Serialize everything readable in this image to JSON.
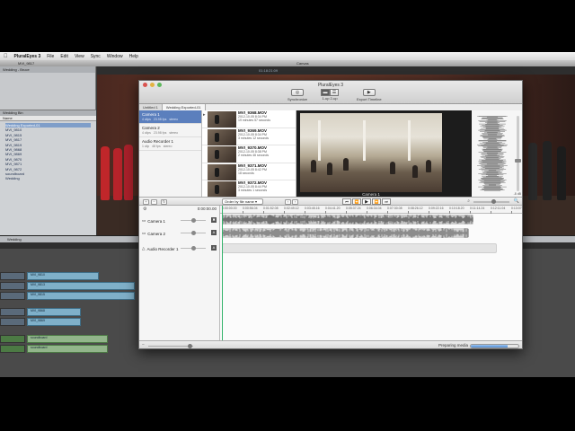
{
  "menubar": {
    "app_name": "PluralEyes 3",
    "items": [
      "File",
      "Edit",
      "View",
      "Sync",
      "Window",
      "Help"
    ]
  },
  "fcp": {
    "viewer_tab": "MVI_9817",
    "canvas_title": "Canvas",
    "browser_title": "Wedding - Bruce",
    "bins_title": "Wedding Bin",
    "bins_column": "Name",
    "bins_items": [
      "Wedding Exported-01",
      "MVI_9810",
      "MVI_9815",
      "MVI_9817",
      "MVI_9819",
      "MVI_9868",
      "MVI_9869",
      "MVI_9870",
      "MVI_9871",
      "MVI_9872",
      "soundboard",
      "Wedding"
    ],
    "timeline_tab": "Wedding",
    "timecode": "01:18:21:09",
    "track_labels": [
      "MVI_9810",
      "MVI_9813",
      "MVI_9815",
      "MVI_9868",
      "MVI_9869",
      "soundboard",
      "soundboard"
    ]
  },
  "pluraleyes": {
    "title": "PluralEyes 3",
    "toolbar": {
      "synchronize_label": "Synchronize",
      "view_label": "1-up   2-up",
      "export_label": "Export Timeline"
    },
    "tabs": [
      "Untitled 1",
      "Wedding Exported-01"
    ],
    "media": [
      {
        "name": "Camera 1",
        "clips": "4 clips",
        "fps": "23.98 fps",
        "status": "stereo"
      },
      {
        "name": "Camera 2",
        "clips": "4 clips",
        "fps": "23.98 fps",
        "status": "stereo"
      },
      {
        "name": "Audio Recorder 1",
        "clips": "1 clip",
        "fps": "48 fps",
        "status": "stereo"
      }
    ],
    "clips": [
      {
        "file": "MVI_9368.MOV",
        "date": "2012-10-05 8:34 PM",
        "duration": "19 minutes 57 seconds"
      },
      {
        "file": "MVI_9369.MOV",
        "date": "2012-10-05 8:34 PM",
        "duration": "3 minutes 12 seconds"
      },
      {
        "file": "MVI_9370.MOV",
        "date": "2012-10-05 8:38 PM",
        "duration": "2 minutes 46 seconds"
      },
      {
        "file": "MVI_9371.MOV",
        "date": "2012-10-05 8:42 PM",
        "duration": "18 seconds"
      },
      {
        "file": "MVI_9372.MOV",
        "date": "2012-10-05 8:44 PM",
        "duration": "3 minutes 1 seconds"
      }
    ],
    "preview_caption": "Camera 1",
    "meter_db": "-8 dB",
    "order_select": "Order by file name",
    "timecode": "0:00:00.00",
    "ruler_ticks": [
      "0:00:00.00",
      "0:00:56.04",
      "0:01:52.08",
      "0:02:49.12",
      "0:03:45.16",
      "0:04:41.20",
      "0:05:37.24",
      "0:06:34.04",
      "0:07:30.08",
      "0:08:26.12",
      "0:09:22.16",
      "0:10:18.20",
      "0:11:14.24",
      "0:12:11.04",
      "0:13:07.08"
    ],
    "tracks": [
      "Camera 1",
      "Camera 2",
      "Audio Recorder 1"
    ],
    "status_text": "Preparing media",
    "progress": 0.78
  }
}
